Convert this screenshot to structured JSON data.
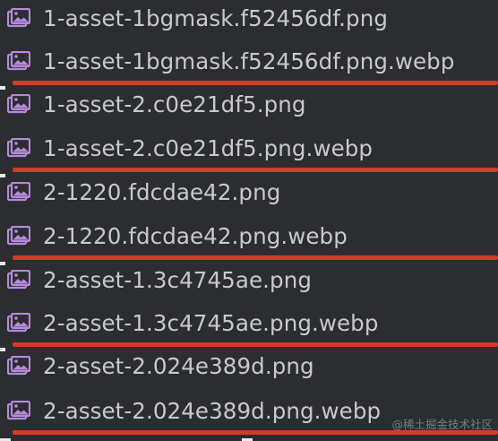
{
  "files": [
    {
      "name": "1-asset-1bgmask.f52456df.png",
      "icon": "image-file-icon",
      "marked": false
    },
    {
      "name": "1-asset-1bgmask.f52456df.png.webp",
      "icon": "image-file-icon",
      "marked": true
    },
    {
      "name": "1-asset-2.c0e21df5.png",
      "icon": "image-file-icon",
      "marked": false
    },
    {
      "name": "1-asset-2.c0e21df5.png.webp",
      "icon": "image-file-icon",
      "marked": true
    },
    {
      "name": "2-1220.fdcdae42.png",
      "icon": "image-file-icon",
      "marked": false
    },
    {
      "name": "2-1220.fdcdae42.png.webp",
      "icon": "image-file-icon",
      "marked": true
    },
    {
      "name": "2-asset-1.3c4745ae.png",
      "icon": "image-file-icon",
      "marked": false
    },
    {
      "name": "2-asset-1.3c4745ae.png.webp",
      "icon": "image-file-icon",
      "marked": true
    },
    {
      "name": "2-asset-2.024e389d.png",
      "icon": "image-file-icon",
      "marked": false
    },
    {
      "name": "2-asset-2.024e389d.png.webp",
      "icon": "image-file-icon",
      "marked": true
    }
  ],
  "watermark": "@稀土掘金技术社区",
  "colors": {
    "background": "#2b2d30",
    "text": "#c8c9cc",
    "icon": "#b58ad9",
    "underline": "#d53a2a"
  }
}
